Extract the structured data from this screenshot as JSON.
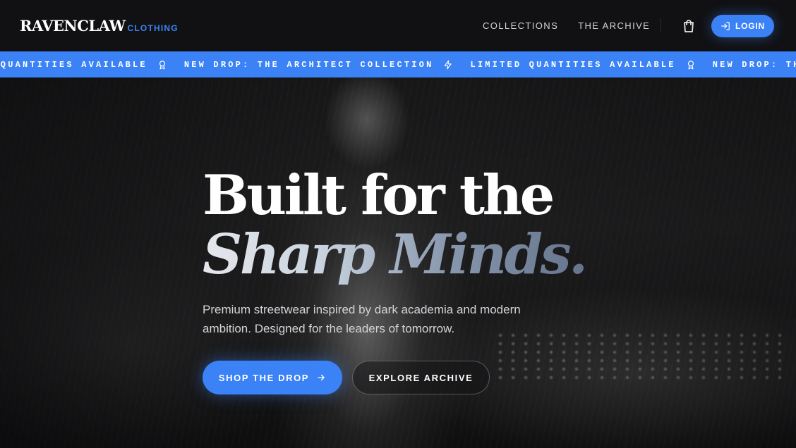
{
  "brand": {
    "name": "RAVENCLAW",
    "sub": "CLOTHING"
  },
  "nav": {
    "links": [
      "COLLECTIONS",
      "THE ARCHIVE"
    ],
    "login_label": "LOGIN",
    "cart_icon": "shopping-bag-icon",
    "login_icon": "login-arrow-icon"
  },
  "ticker": {
    "items": [
      {
        "text": "D QUANTITIES AVAILABLE",
        "icon": "award-icon"
      },
      {
        "text": "NEW DROP: THE ARCHITECT COLLECTION",
        "icon": "lightning-icon"
      },
      {
        "text": "LIMITED QUANTITIES AVAILABLE",
        "icon": "award-icon"
      },
      {
        "text": "NEW DROP: THE ARCHITECT COLLECTION",
        "icon": "lightning-icon"
      }
    ]
  },
  "hero": {
    "headline_line1": "Built for the",
    "headline_line2": "Sharp Minds.",
    "tagline": "Premium streetwear inspired by dark academia and modern ambition. Designed for the leaders of tomorrow.",
    "primary_cta": "SHOP THE DROP",
    "secondary_cta": "EXPLORE ARCHIVE"
  },
  "colors": {
    "accent": "#3b82f6",
    "nav_bg": "#111113"
  }
}
